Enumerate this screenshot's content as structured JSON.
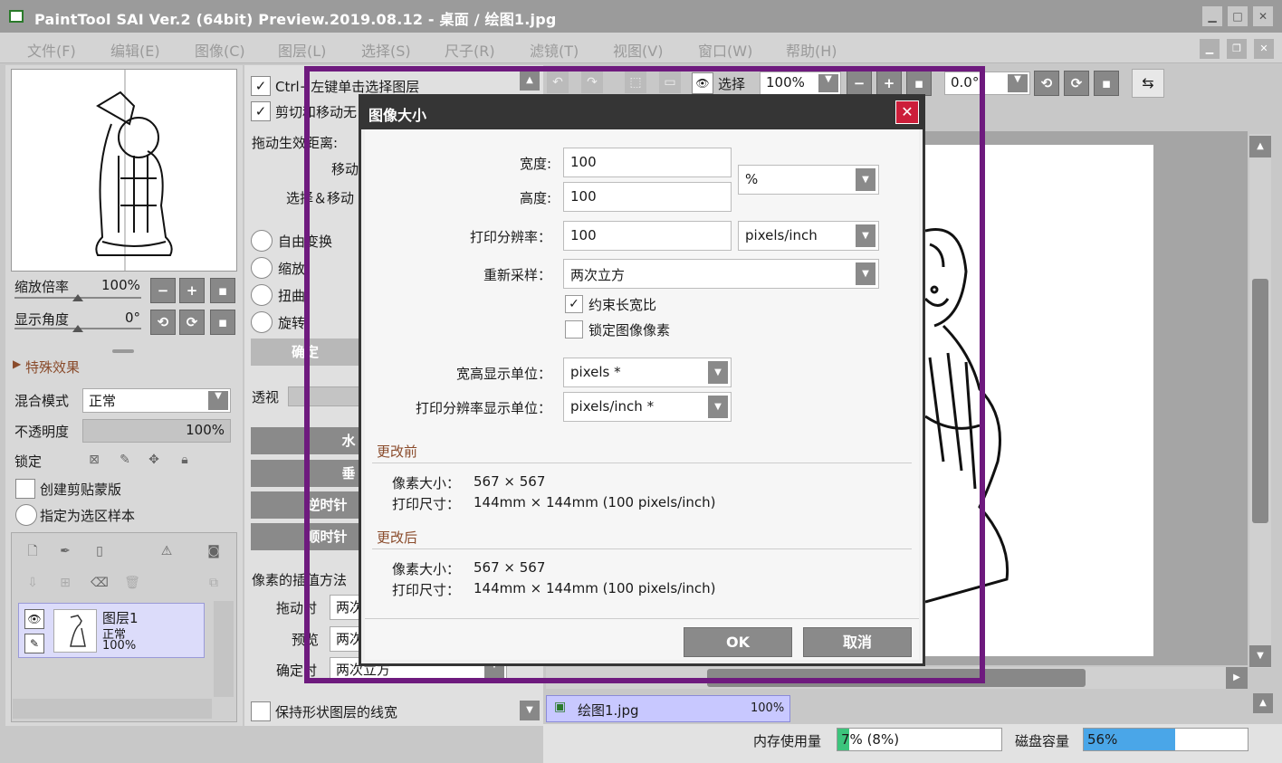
{
  "window": {
    "title": "PaintTool SAI Ver.2 (64bit) Preview.2019.08.12 - 桌面 / 绘图1.jpg",
    "buttons": [
      "▁",
      "□",
      "✕"
    ]
  },
  "menu": [
    "文件(F)",
    "编辑(E)",
    "图像(C)",
    "图层(L)",
    "选择(S)",
    "尺子(R)",
    "滤镜(T)",
    "视图(V)",
    "窗口(W)",
    "帮助(H)"
  ],
  "navigator": {
    "zoom_label": "缩放倍率",
    "zoom_value": "100%",
    "angle_label": "显示角度",
    "angle_value": "0°",
    "effects_label": "特殊效果"
  },
  "layer_props": {
    "blend_label": "混合模式",
    "blend_value": "正常",
    "opacity_label": "不透明度",
    "opacity_value": "100%",
    "lock_label": "锁定",
    "clip_label": "创建剪贴蒙版",
    "sample_label": "指定为选区样本"
  },
  "layers": [
    {
      "name": "图层1",
      "mode": "正常",
      "opacity": "100%"
    }
  ],
  "tool_options": {
    "ctrl_click": "Ctrl+左键单击选择图层",
    "cut_move": "剪切和移动无",
    "drag_distance": "拖动生效距离:",
    "move": "移动",
    "select_move": "选择＆移动",
    "free_transform": "自由变换",
    "scale": "缩放",
    "distort": "扭曲",
    "rotate": "旋转",
    "confirm": "确定",
    "perspective": "透视",
    "btn1": "水",
    "btn2": "垂",
    "btn3": "逆时针",
    "btn4": "顺时针",
    "interp_label": "像素的插值方法",
    "drag_when": "拖动时",
    "drag_when_value": "两次",
    "preview": "预览",
    "preview_value": "两次",
    "confirm_when": "确定时",
    "confirm_when_value": "两次立方",
    "keep_line": "保持形状图层的线宽"
  },
  "toolbar": {
    "select_label": "选择",
    "zoom": "100%",
    "angle": "0.0°"
  },
  "dialog": {
    "title": "图像大小",
    "width_label": "宽度:",
    "width_value": "100",
    "height_label": "高度:",
    "height_value": "100",
    "unit_value": "%",
    "res_label": "打印分辨率：",
    "res_value": "100",
    "res_unit": "pixels/inch",
    "resample_label": "重新采样：",
    "resample_value": "两次立方",
    "constrain_label": "约束长宽比",
    "lock_pixels_label": "锁定图像像素",
    "display_unit_label": "宽高显示单位：",
    "display_unit_value": "pixels *",
    "res_display_label": "打印分辨率显示单位：",
    "res_display_value": "pixels/inch *",
    "before_label": "更改前",
    "before_pixel_label": "像素大小：",
    "before_pixel_value": "567 × 567",
    "before_print_label": "打印尺寸：",
    "before_print_value": "144mm × 144mm (100 pixels/inch)",
    "after_label": "更改后",
    "after_pixel_label": "像素大小：",
    "after_pixel_value": "567 × 567",
    "after_print_label": "打印尺寸：",
    "after_print_value": "144mm × 144mm (100 pixels/inch)",
    "ok": "OK",
    "cancel": "取消"
  },
  "document_tab": {
    "name": "绘图1.jpg",
    "zoom": "100%"
  },
  "status": {
    "memory_label": "内存使用量",
    "memory_value": "7% (8%)",
    "memory_fraction": 0.07,
    "disk_label": "磁盘容量",
    "disk_value": "56%",
    "disk_fraction": 0.56
  },
  "colors": {
    "frame": "#6e1a7e",
    "close": "#cc1e3a",
    "memory_fill": "#3cc47c",
    "disk_fill": "#4aa6e8"
  }
}
